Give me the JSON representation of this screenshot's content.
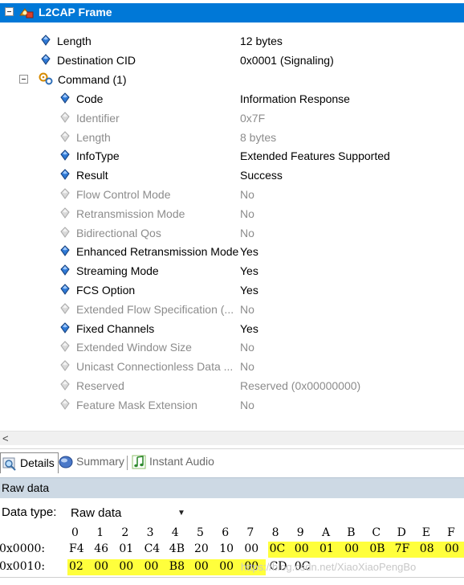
{
  "tree": {
    "frame_title": "L2CAP Frame",
    "rows": [
      {
        "label": "Length",
        "value": "12 bytes",
        "enabled": true
      },
      {
        "label": "Destination CID",
        "value": "0x0001 (Signaling)",
        "enabled": true
      }
    ],
    "command_label": "Command (1)",
    "command_rows": [
      {
        "label": "Code",
        "value": "Information Response",
        "enabled": true
      },
      {
        "label": "Identifier",
        "value": "0x7F",
        "enabled": false
      },
      {
        "label": "Length",
        "value": "8 bytes",
        "enabled": false
      },
      {
        "label": "InfoType",
        "value": "Extended Features Supported",
        "enabled": true
      },
      {
        "label": "Result",
        "value": "Success",
        "enabled": true
      },
      {
        "label": "Flow Control Mode",
        "value": "No",
        "enabled": false
      },
      {
        "label": "Retransmission Mode",
        "value": "No",
        "enabled": false
      },
      {
        "label": "Bidirectional Qos",
        "value": "No",
        "enabled": false
      },
      {
        "label": "Enhanced Retransmission Mode",
        "value": "Yes",
        "enabled": true
      },
      {
        "label": "Streaming Mode",
        "value": "Yes",
        "enabled": true
      },
      {
        "label": "FCS Option",
        "value": "Yes",
        "enabled": true
      },
      {
        "label": "Extended Flow Specification (...",
        "value": "No",
        "enabled": false
      },
      {
        "label": "Fixed Channels",
        "value": "Yes",
        "enabled": true
      },
      {
        "label": "Extended Window Size",
        "value": "No",
        "enabled": false
      },
      {
        "label": "Unicast Connectionless Data ...",
        "value": "No",
        "enabled": false
      },
      {
        "label": "Reserved",
        "value": "Reserved (0x00000000)",
        "enabled": false
      },
      {
        "label": "Feature Mask Extension",
        "value": "No",
        "enabled": false
      }
    ]
  },
  "scrollbar": {
    "left_arrow": "<"
  },
  "tabs": {
    "details": "Details",
    "summary": "Summary",
    "instant_audio": "Instant Audio"
  },
  "raw": {
    "title": "Raw data",
    "data_type_label": "Data type:",
    "data_type_value": "Raw data",
    "columns": [
      "0",
      "1",
      "2",
      "3",
      "4",
      "5",
      "6",
      "7",
      "8",
      "9",
      "A",
      "B",
      "C",
      "D",
      "E",
      "F"
    ],
    "rows": [
      {
        "offset": "0x0000:",
        "bytes": [
          "F4",
          "46",
          "01",
          "C4",
          "4B",
          "20",
          "10",
          "00",
          "0C",
          "00",
          "01",
          "00",
          "0B",
          "7F",
          "08",
          "00"
        ],
        "highlight_from": 8,
        "highlight_to": 15
      },
      {
        "offset": "0x0010:",
        "bytes": [
          "02",
          "00",
          "00",
          "00",
          "B8",
          "00",
          "00",
          "00",
          "CD",
          "0C"
        ],
        "highlight_from": 0,
        "highlight_to": 7
      }
    ]
  },
  "watermark": "https://blog.csdn.net/XiaoXiaoPengBo",
  "colors": {
    "header_bg": "#0078d7",
    "highlight": "#ffff3c",
    "gray_text": "#8c8c8c",
    "raw_title_bg": "#cdd9e4"
  }
}
